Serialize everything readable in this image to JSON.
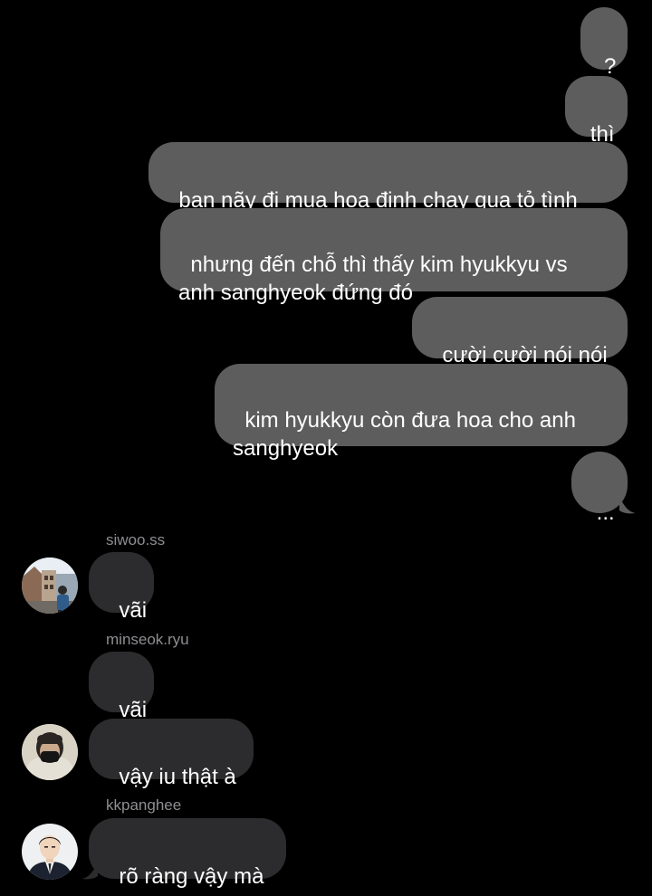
{
  "outgoing": [
    {
      "id": "q",
      "text": "?"
    },
    {
      "id": "thi",
      "text": "thì"
    },
    {
      "id": "m1",
      "text": "ban nãy đi mua hoa định chạy qua tỏ tình"
    },
    {
      "id": "m2",
      "text": "nhưng đến chỗ thì thấy kim hyukkyu vs anh sanghyeok đứng đó"
    },
    {
      "id": "m3",
      "text": "cười cười nói nói"
    },
    {
      "id": "m4",
      "text": "kim hyukkyu còn đưa hoa cho anh sanghyeok"
    },
    {
      "id": "dots",
      "text": "..."
    }
  ],
  "incoming": [
    {
      "sender": "siwoo.ss",
      "messages": [
        "vãi"
      ],
      "avatar": "avatar-street-photo"
    },
    {
      "sender": "minseok.ryu",
      "messages": [
        "vãi",
        "vậy iu thật à"
      ],
      "avatar": "avatar-masked-person"
    },
    {
      "sender": "kkpanghee",
      "messages": [
        "rõ ràng vậy mà"
      ],
      "avatar": "avatar-suit-portrait"
    }
  ],
  "colors": {
    "background": "#000000",
    "outgoing_bubble": "#5d5d5d",
    "incoming_bubble": "#2c2c2e",
    "sender_name": "#8e8e93"
  }
}
